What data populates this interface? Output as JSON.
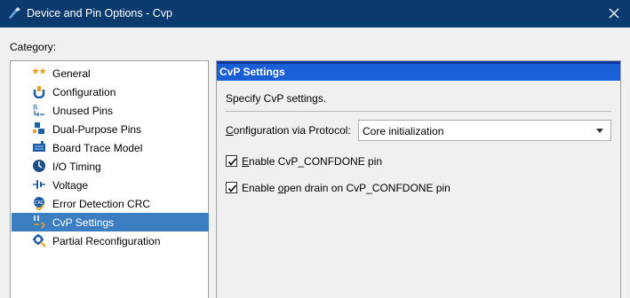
{
  "window": {
    "title": "Device and Pin Options - Cvp",
    "close_icon": "close-icon",
    "app_icon": "quartus-icon"
  },
  "category_label": "Category:",
  "sidebar": {
    "items": [
      {
        "label": "General",
        "icon": "stars-icon"
      },
      {
        "label": "Configuration",
        "icon": "configuration-icon"
      },
      {
        "label": "Unused Pins",
        "icon": "unused-pins-icon"
      },
      {
        "label": "Dual-Purpose Pins",
        "icon": "dual-purpose-pins-icon"
      },
      {
        "label": "Board Trace Model",
        "icon": "board-trace-icon"
      },
      {
        "label": "I/O Timing",
        "icon": "clock-icon"
      },
      {
        "label": "Voltage",
        "icon": "voltage-icon"
      },
      {
        "label": "Error Detection CRC",
        "icon": "error-detection-icon"
      },
      {
        "label": "CvP Settings",
        "icon": "cvp-settings-icon",
        "selected": true
      },
      {
        "label": "Partial Reconfiguration",
        "icon": "partial-reconfiguration-icon"
      }
    ]
  },
  "panel": {
    "header": "CvP Settings",
    "description": "Specify CvP settings.",
    "protocol": {
      "label_first": "C",
      "label_rest": "onfiguration via Protocol:",
      "value": "Core initialization"
    },
    "checkboxes": [
      {
        "pre": "",
        "mnemonic": "E",
        "post": "nable CvP_CONFDONE pin",
        "checked": true
      },
      {
        "pre": "Enable ",
        "mnemonic": "o",
        "post": "pen drain on CvP_CONFDONE pin",
        "checked": true
      }
    ]
  },
  "colors": {
    "titlebar": "#0b3a6e",
    "selected_item": "#3c7ec2",
    "panel_header": "#1a5fd6"
  }
}
